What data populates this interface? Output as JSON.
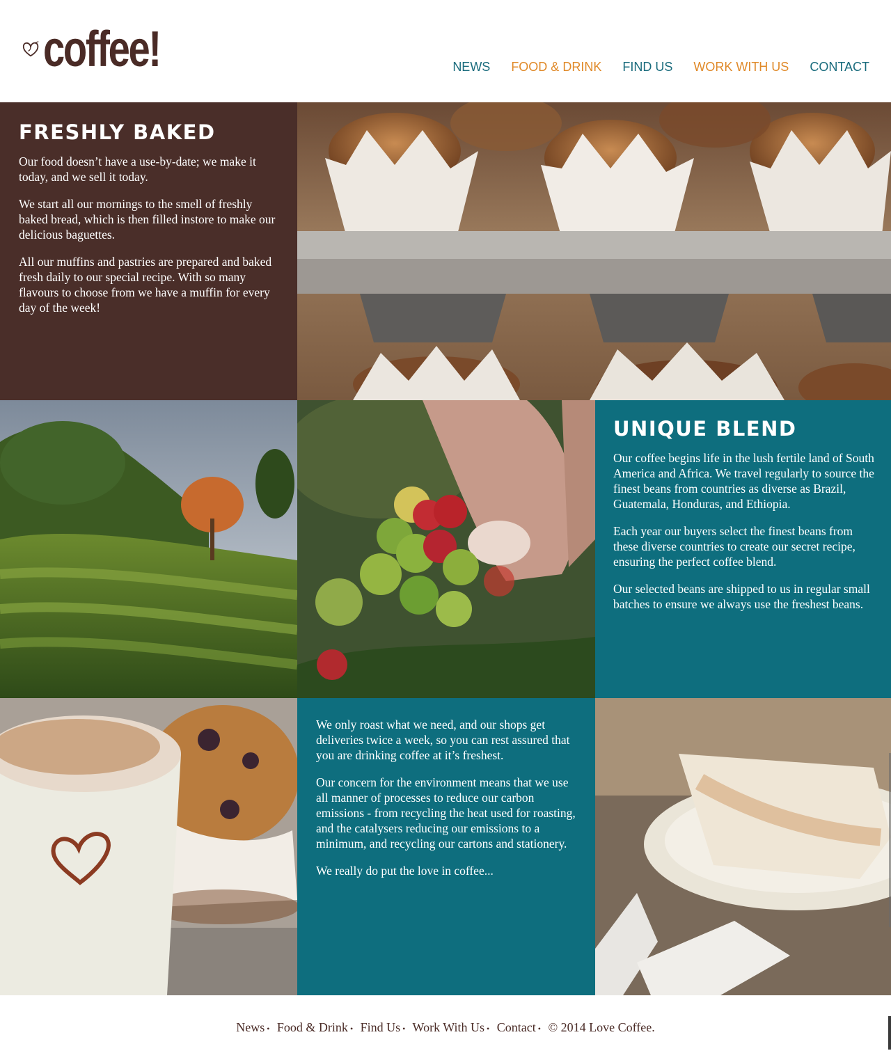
{
  "brand": {
    "logo_text": "coffee!",
    "logo_icon": "heart-icon"
  },
  "nav": {
    "items": [
      {
        "label": "NEWS",
        "color": "#1a6c7d"
      },
      {
        "label": "FOOD & DRINK",
        "color": "#e08a2a"
      },
      {
        "label": "FIND US",
        "color": "#1a6c7d"
      },
      {
        "label": "WORK WITH US",
        "color": "#e08a2a"
      },
      {
        "label": "CONTACT",
        "color": "#1a6c7d"
      }
    ]
  },
  "freshly_baked": {
    "title": "FRESHLY BAKED",
    "paragraphs": [
      "Our food doesn’t have a use-by-date; we make it today, and we sell it today.",
      "We start all our mornings to the smell of freshly baked bread, which is then filled instore to make our delicious baguettes.",
      "All our muffins and pastries are prepared and baked fresh daily to our special recipe. With so many flavours to choose from we have a muffin for every day of the week!"
    ]
  },
  "unique_blend": {
    "title": "UNIQUE BLEND",
    "paragraphs": [
      "Our coffee begins life in the lush fertile land of South America and Africa. We travel regularly to source the finest beans from countries as diverse as Brazil, Guatemala, Honduras, and Ethiopia.",
      "Each year our buyers select the finest beans from these diverse countries to create our secret recipe, ensuring the perfect coffee blend.",
      "Our selected beans are shipped to us in regular small batches to ensure we always use the freshest beans."
    ]
  },
  "roasting": {
    "paragraphs": [
      "We only roast what we need, and our shops get deliveries twice a week, so you can rest assured that you are drinking coffee at it’s freshest.",
      "Our concern for the environment means that we use all manner of processes to reduce our carbon emissions - from recycling the heat used for roasting, and the catalysers reducing our emissions to a minimum, and recycling our cartons and stationery.",
      "We really do put the love in coffee..."
    ]
  },
  "footer": {
    "links": [
      "News",
      "Food & Drink",
      "Find Us",
      "Work With Us",
      "Contact"
    ],
    "separator": "•",
    "copyright": "© 2014 Love Coffee."
  },
  "colors": {
    "brown": "#4a2e29",
    "teal": "#0e6e7e",
    "nav_teal": "#1a6c7d",
    "nav_orange": "#e08a2a"
  }
}
